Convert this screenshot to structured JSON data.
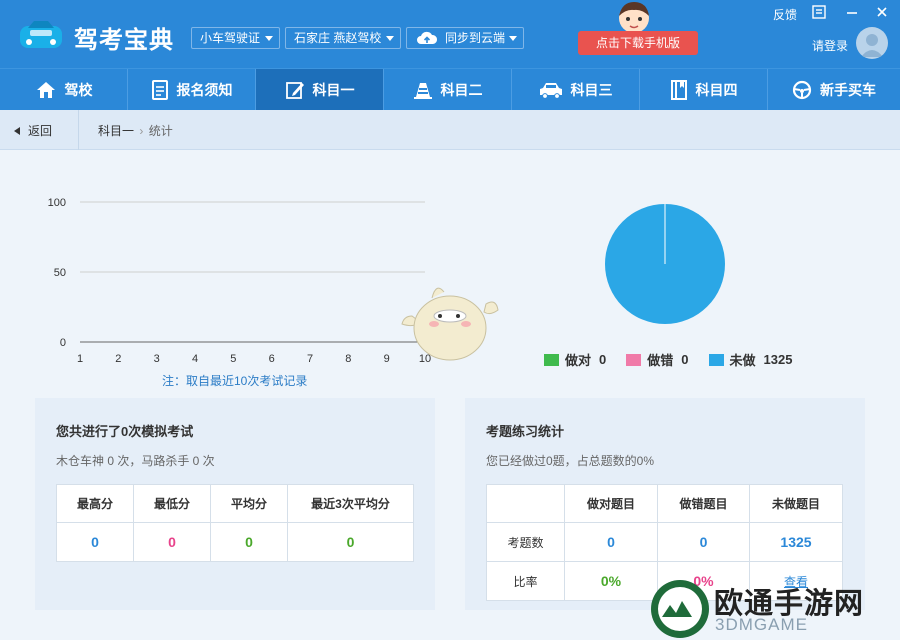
{
  "app": {
    "title": "驾考宝典",
    "car_type": "小车驾驶证",
    "school": "石家庄 燕赵驾校",
    "sync": "同步到云端",
    "download": "点击下载手机版",
    "feedback": "反馈",
    "login": "请登录"
  },
  "nav": [
    {
      "label": "驾校",
      "icon": "home-icon"
    },
    {
      "label": "报名须知",
      "icon": "document-icon"
    },
    {
      "label": "科目一",
      "icon": "edit-icon"
    },
    {
      "label": "科目二",
      "icon": "cone-icon"
    },
    {
      "label": "科目三",
      "icon": "car-icon"
    },
    {
      "label": "科目四",
      "icon": "book-icon"
    },
    {
      "label": "新手买车",
      "icon": "steering-wheel-icon"
    }
  ],
  "breadcrumb": {
    "back": "返回",
    "parent": "科目一",
    "sep": "›",
    "current": "统计"
  },
  "chart_data": [
    {
      "type": "line",
      "x": [
        1,
        2,
        3,
        4,
        5,
        6,
        7,
        8,
        9,
        10
      ],
      "series": [],
      "ylim": [
        0,
        100
      ],
      "yticks": [
        0,
        50,
        100
      ],
      "grid": true,
      "note": "注：取自最近10次考试记录"
    },
    {
      "type": "pie",
      "categories": [
        "做对",
        "做错",
        "未做"
      ],
      "values": [
        0,
        0,
        1325
      ],
      "colors": [
        "#3fba4d",
        "#f07aa8",
        "#2ba7e6"
      ],
      "legend": "bottom"
    }
  ],
  "exam": {
    "title": "您共进行了0次模拟考试",
    "sub": "木仓车神 0 次，马路杀手 0 次",
    "headers": [
      "最高分",
      "最低分",
      "平均分",
      "最近3次平均分"
    ],
    "values": [
      "0",
      "0",
      "0",
      "0"
    ]
  },
  "practice": {
    "title": "考题练习统计",
    "sub": "您已经做过0题，占总题数的0%",
    "headers": [
      "",
      "做对题目",
      "做错题目",
      "未做题目"
    ],
    "row1_label": "考题数",
    "row1": [
      "0",
      "0",
      "1325"
    ],
    "row2_label": "比率",
    "row2": [
      "0%",
      "0%",
      "查看"
    ]
  },
  "watermark": {
    "text": "欧通手游网",
    "sub": "3DMGAME"
  }
}
